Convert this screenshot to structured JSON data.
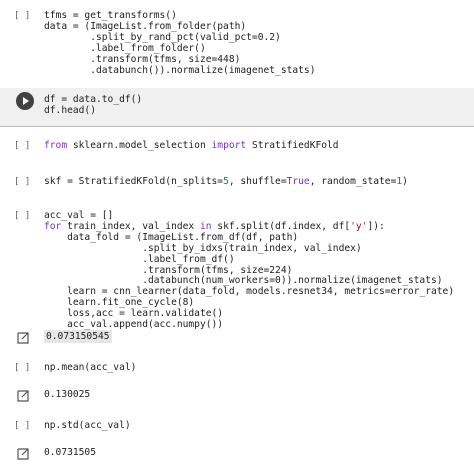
{
  "gutter_label": "[ ]",
  "cells": {
    "c1": {
      "l1": "tfms = get_transforms()",
      "l2": "data = (ImageList.from_folder(path)",
      "l3": "        .split_by_rand_pct(valid_pct=0.2)",
      "l4": "        .label_from_folder()",
      "l5": "        .transform(tfms, size=448)",
      "l6": "        .databunch()).normalize(imagenet_stats)"
    },
    "c2": {
      "l1": "df = data.to_df()",
      "l2": "df.head()"
    },
    "c3": {
      "kw1": "from",
      "mid": " sklearn.model_selection ",
      "kw2": "import",
      "end": " StratifiedKFold"
    },
    "c4": {
      "a": "skf = StratifiedKFold(n_splits=",
      "n1": "5",
      "b": ", shuffle=",
      "t": "True",
      "c": ", random_state=",
      "n2": "1",
      "d": ")"
    },
    "c5": {
      "l1": "acc_val = []",
      "l2a": "for",
      "l2b": " train_index, val_index ",
      "l2c": "in",
      "l2d": " skf.split(df.index, df[",
      "l2s": "'y'",
      "l2e": "]):",
      "l3": "    data_fold = (ImageList.from_df(df, path)",
      "l4": "                 .split_by_idxs(train_index, val_index)",
      "l5": "                 .label_from_df()",
      "l6": "                 .transform(tfms, size=224)",
      "l7": "                 .databunch(num_workers=0)).normalize(imagenet_stats)",
      "l8": "    learn = cnn_learner(data_fold, models.resnet34, metrics=error_rate)",
      "l9": "    learn.fit_one_cycle(8)",
      "l10": "    loss,acc = learn.validate()",
      "l11": "    acc_val.append(acc.numpy())"
    },
    "out1": "0.073150545",
    "c6": "np.mean(acc_val)",
    "out2": "0.130025",
    "c7": "np.std(acc_val)",
    "out3": "0.0731505"
  }
}
